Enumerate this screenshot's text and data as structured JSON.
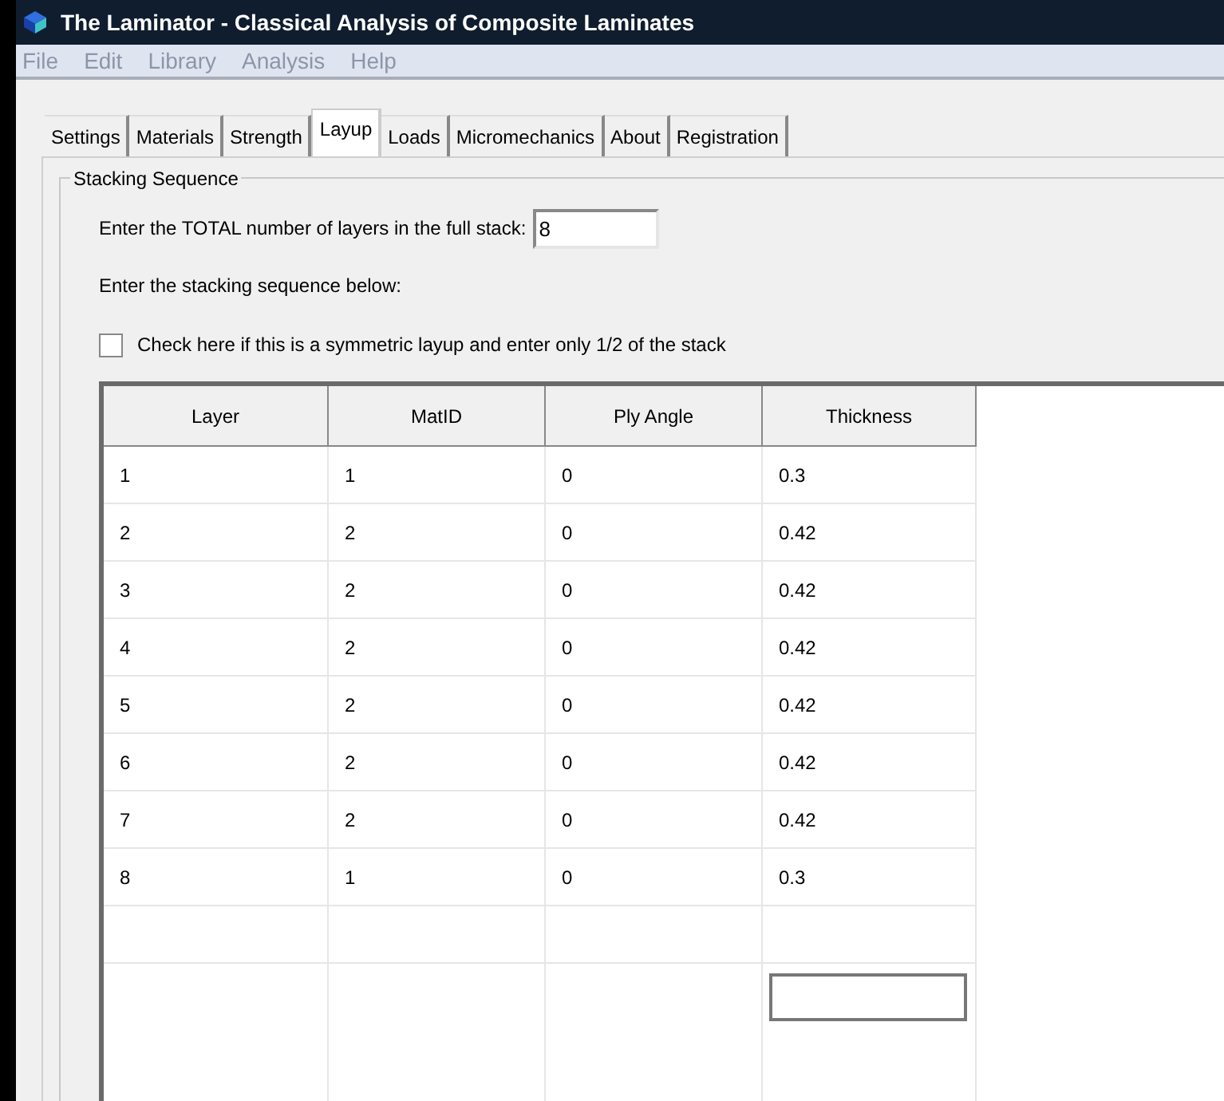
{
  "window": {
    "title": "The Laminator - Classical Analysis of Composite Laminates"
  },
  "menu": [
    {
      "label": "File",
      "disabled": true
    },
    {
      "label": "Edit",
      "disabled": true
    },
    {
      "label": "Library",
      "disabled": true
    },
    {
      "label": "Analysis",
      "disabled": true
    },
    {
      "label": "Help",
      "disabled": true
    }
  ],
  "tabs": [
    {
      "label": "Settings",
      "selected": false
    },
    {
      "label": "Materials",
      "selected": false
    },
    {
      "label": "Strength",
      "selected": false
    },
    {
      "label": "Layup",
      "selected": true
    },
    {
      "label": "Loads",
      "selected": false
    },
    {
      "label": "Micromechanics",
      "selected": false
    },
    {
      "label": "About",
      "selected": false
    },
    {
      "label": "Registration",
      "selected": false
    }
  ],
  "group": {
    "title": "Stacking Sequence",
    "total_label": "Enter the TOTAL number of layers in the full stack:",
    "total_value": "8",
    "sequence_label": "Enter the stacking sequence below:",
    "symmetric": {
      "label": "Check here if this is a symmetric layup and enter only 1/2 of the stack",
      "checked": false
    }
  },
  "table": {
    "columns": [
      "Layer",
      "MatID",
      "Ply Angle",
      "Thickness"
    ],
    "rows": [
      [
        "1",
        "1",
        "0",
        "0.3"
      ],
      [
        "2",
        "2",
        "0",
        "0.42"
      ],
      [
        "3",
        "2",
        "0",
        "0.42"
      ],
      [
        "4",
        "2",
        "0",
        "0.42"
      ],
      [
        "5",
        "2",
        "0",
        "0.42"
      ],
      [
        "6",
        "2",
        "0",
        "0.42"
      ],
      [
        "7",
        "2",
        "0",
        "0.42"
      ],
      [
        "8",
        "1",
        "0",
        "0.3"
      ]
    ]
  }
}
